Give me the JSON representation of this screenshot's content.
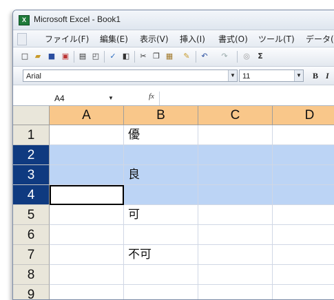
{
  "window": {
    "title": "Microsoft Excel - Book1",
    "app_icon": "excel-icon"
  },
  "menu": [
    "ファイル(F)",
    "編集(E)",
    "表示(V)",
    "挿入(I)",
    "書式(O)",
    "ツール(T)",
    "データ(D)"
  ],
  "toolbar": {
    "icons": [
      "new-icon",
      "open-icon",
      "save-icon",
      "permission-icon",
      "print-icon",
      "print-preview-icon",
      "spelling-icon",
      "research-icon",
      "cut-icon",
      "copy-icon",
      "paste-icon",
      "format-painter-icon",
      "undo-icon",
      "redo-icon",
      "hyperlink-icon",
      "autosum-icon"
    ]
  },
  "format": {
    "font": "Arial",
    "size": "11",
    "bold": "B",
    "italic": "I"
  },
  "formula": {
    "namebox": "A4",
    "fx": "fx",
    "content": ""
  },
  "sheet": {
    "columns": [
      "A",
      "B",
      "C",
      "D"
    ],
    "rows": [
      {
        "num": "1",
        "cells": [
          "",
          "優",
          "",
          ""
        ]
      },
      {
        "num": "2",
        "cells": [
          "",
          "",
          "",
          ""
        ]
      },
      {
        "num": "3",
        "cells": [
          "",
          "良",
          "",
          ""
        ]
      },
      {
        "num": "4",
        "cells": [
          "",
          "",
          "",
          ""
        ]
      },
      {
        "num": "5",
        "cells": [
          "",
          "可",
          "",
          ""
        ]
      },
      {
        "num": "6",
        "cells": [
          "",
          "",
          "",
          ""
        ]
      },
      {
        "num": "7",
        "cells": [
          "",
          "不可",
          "",
          ""
        ]
      },
      {
        "num": "8",
        "cells": [
          "",
          "",
          "",
          ""
        ]
      },
      {
        "num": "9",
        "cells": [
          "",
          "",
          "",
          ""
        ]
      }
    ],
    "highlighted_rows": [
      "2",
      "3",
      "4"
    ],
    "active_cell": "A4",
    "colors": {
      "column_header": "#f9c78a",
      "selected_row_header": "#0f3a80",
      "highlight": "#bcd4f5"
    }
  }
}
